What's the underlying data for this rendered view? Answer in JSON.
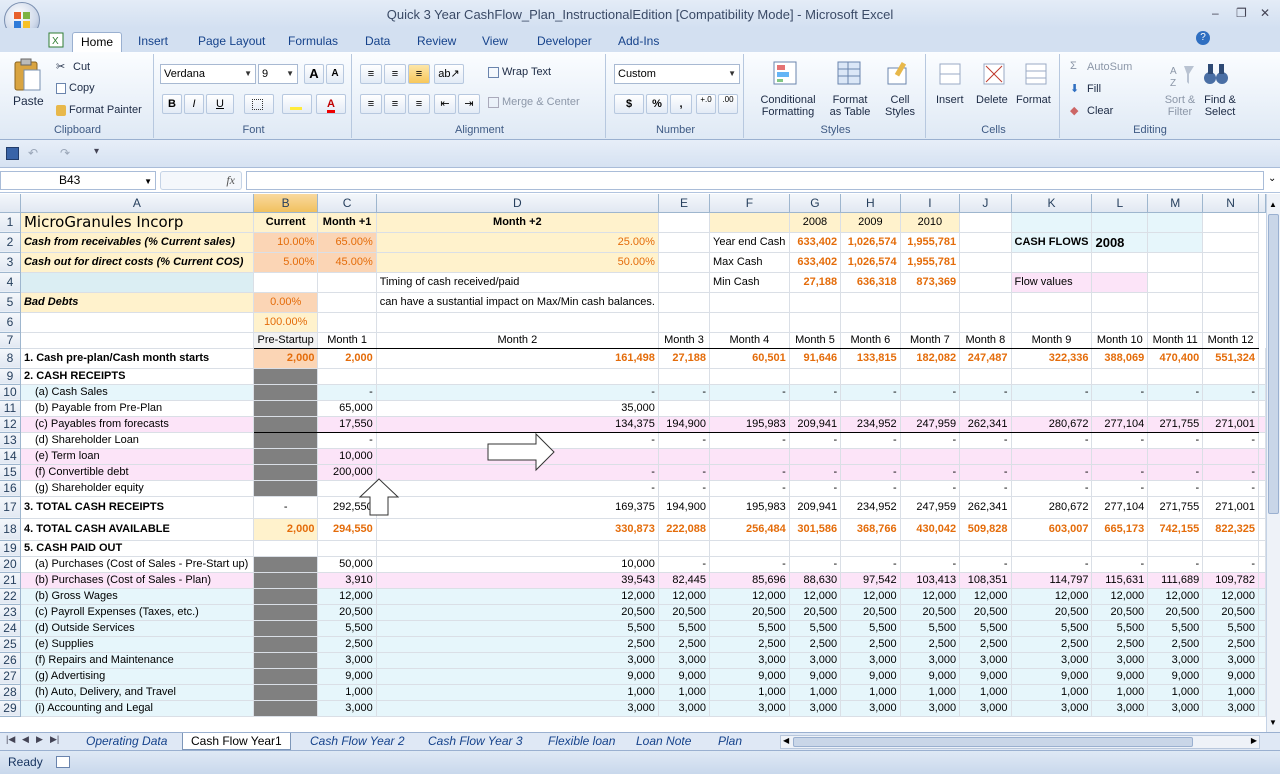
{
  "window": {
    "title": "Quick 3 Year CashFlow_Plan_InstructionalEdition  [Compatibility Mode] - Microsoft Excel",
    "minimize": "–",
    "restore": "❐",
    "close": "✕"
  },
  "ribbon_tabs": [
    "Home",
    "Insert",
    "Page Layout",
    "Formulas",
    "Data",
    "Review",
    "View",
    "Developer",
    "Add-Ins"
  ],
  "ribbon": {
    "clipboard": {
      "label": "Clipboard",
      "paste": "Paste",
      "cut": "Cut",
      "copy": "Copy",
      "format_painter": "Format Painter"
    },
    "font": {
      "label": "Font",
      "name": "Verdana",
      "size": "9",
      "grow": "A",
      "shrink": "A",
      "bold": "B",
      "italic": "I",
      "underline": "U"
    },
    "alignment": {
      "label": "Alignment",
      "wrap_text": "Wrap Text",
      "merge_center": "Merge & Center"
    },
    "number": {
      "label": "Number",
      "format": "Custom",
      "currency": "$",
      "percent": "%",
      "comma": ",",
      "inc_dec": "←.0\n.00",
      "dec_dec": ".00\n→.0"
    },
    "styles": {
      "label": "Styles",
      "conditional": "Conditional",
      "conditional2": "Formatting",
      "format_table": "Format",
      "format_table2": "as Table",
      "cell_styles": "Cell",
      "cell_styles2": "Styles"
    },
    "cells": {
      "label": "Cells",
      "insert": "Insert",
      "delete": "Delete",
      "format": "Format"
    },
    "editing": {
      "label": "Editing",
      "autosum": "AutoSum",
      "fill": "Fill",
      "clear": "Clear",
      "sort": "Sort &",
      "sort2": "Filter",
      "find": "Find &",
      "find2": "Select"
    }
  },
  "formula_bar": {
    "name_box": "B43",
    "fx": "fx",
    "formula": ""
  },
  "columns": [
    "A",
    "B",
    "C",
    "D",
    "E",
    "F",
    "G",
    "H",
    "I",
    "J",
    "K",
    "L",
    "M",
    "N"
  ],
  "selected_column": "B",
  "header_block": {
    "company": "MicroGranules Incorp",
    "current": "Current",
    "month1": "Month +1",
    "month2": "Month +2",
    "receivables_label": "Cash from receivables (% Current sales)",
    "receivables": [
      "10.00%",
      "65.00%",
      "25.00%"
    ],
    "cashout_label": "Cash out for direct costs (% Current COS)",
    "cashout": [
      "5.00%",
      "45.00%",
      "50.00%"
    ],
    "bad_debts_label": "Bad Debts",
    "bad_debts": "0.00%",
    "total_pct": "100.00%",
    "note1": "Timing of cash received/paid",
    "note2": "can have a sustantial impact on Max/Min cash balances.",
    "years": [
      "2008",
      "2009",
      "2010"
    ],
    "year_end_label": "Year end Cash",
    "year_end": [
      "633,402",
      "1,026,574",
      "1,955,781"
    ],
    "max_label": "Max Cash",
    "max": [
      "633,402",
      "1,026,574",
      "1,955,781"
    ],
    "min_label": "Min Cash",
    "min": [
      "27,188",
      "636,318",
      "873,369"
    ],
    "cashflows_label": "CASH FLOWS",
    "cashflows_year": "2008",
    "flow_values": "Flow values"
  },
  "months_header": [
    "Pre-Startup",
    "Month 1",
    "Month 2",
    "Month 3",
    "Month 4",
    "Month 5",
    "Month 6",
    "Month 7",
    "Month 8",
    "Month 9",
    "Month 10",
    "Month 11",
    "Month 12"
  ],
  "rows": [
    {
      "n": "8",
      "label": "1. Cash pre-plan/Cash month starts",
      "style": "start",
      "vals": [
        "2,000",
        "2,000",
        "161,498",
        "27,188",
        "60,501",
        "91,646",
        "133,815",
        "182,082",
        "247,487",
        "322,336",
        "388,069",
        "470,400",
        "551,324"
      ]
    },
    {
      "n": "9",
      "label": "2. CASH RECEIPTS",
      "style": "section",
      "vals": [
        "",
        "",
        "",
        "",
        "",
        "",
        "",
        "",
        "",
        "",
        "",
        "",
        ""
      ]
    },
    {
      "n": "10",
      "label": "(a) Cash Sales",
      "style": "cyan",
      "vals": [
        "",
        "-",
        "-",
        "-",
        "-",
        "-",
        "-",
        "-",
        "-",
        "-",
        "-",
        "-",
        "-"
      ]
    },
    {
      "n": "11",
      "label": "(b) Payable from Pre-Plan",
      "style": "plain",
      "vals": [
        "",
        "65,000",
        "35,000",
        "",
        "",
        "",
        "",
        "",
        "",
        "",
        "",
        "",
        ""
      ]
    },
    {
      "n": "12",
      "label": "(c) Payables from forecasts",
      "style": "pinkbox",
      "vals": [
        "",
        "17,550",
        "134,375",
        "194,900",
        "195,983",
        "209,941",
        "234,952",
        "247,959",
        "262,341",
        "280,672",
        "277,104",
        "271,755",
        "271,001"
      ]
    },
    {
      "n": "13",
      "label": "(d) Shareholder Loan",
      "style": "plain",
      "vals": [
        "",
        "-",
        "-",
        "-",
        "-",
        "-",
        "-",
        "-",
        "-",
        "-",
        "-",
        "-",
        "-"
      ]
    },
    {
      "n": "14",
      "label": "(e) Term loan",
      "style": "pink",
      "vals": [
        "",
        "10,000",
        "",
        "",
        "",
        "",
        "",
        "",
        "",
        "",
        "",
        "",
        ""
      ]
    },
    {
      "n": "15",
      "label": "(f) Convertible debt",
      "style": "pink",
      "vals": [
        "",
        "200,000",
        "-",
        "-",
        "-",
        "-",
        "-",
        "-",
        "-",
        "-",
        "-",
        "-",
        "-"
      ]
    },
    {
      "n": "16",
      "label": "(g) Shareholder equity",
      "style": "plain",
      "vals": [
        "",
        "-",
        "-",
        "-",
        "-",
        "-",
        "-",
        "-",
        "-",
        "-",
        "-",
        "-",
        "-"
      ]
    },
    {
      "n": "17",
      "label": "3. TOTAL CASH RECEIPTS",
      "style": "total",
      "vals": [
        "-",
        "292,550",
        "169,375",
        "194,900",
        "195,983",
        "209,941",
        "234,952",
        "247,959",
        "262,341",
        "280,672",
        "277,104",
        "271,755",
        "271,001"
      ]
    },
    {
      "n": "18",
      "label": "4. TOTAL CASH AVAILABLE",
      "style": "available",
      "vals": [
        "2,000",
        "294,550",
        "330,873",
        "222,088",
        "256,484",
        "301,586",
        "368,766",
        "430,042",
        "509,828",
        "603,007",
        "665,173",
        "742,155",
        "822,325"
      ]
    },
    {
      "n": "19",
      "label": "5. CASH PAID OUT",
      "style": "section",
      "vals": [
        "",
        "",
        "",
        "",
        "",
        "",
        "",
        "",
        "",
        "",
        "",
        "",
        ""
      ]
    },
    {
      "n": "20",
      "label": "(a) Purchases (Cost of Sales - Pre-Start up)",
      "style": "plain",
      "vals": [
        "",
        "50,000",
        "10,000",
        "-",
        "-",
        "-",
        "-",
        "-",
        "-",
        "-",
        "-",
        "-",
        "-"
      ]
    },
    {
      "n": "21",
      "label": "(b) Purchases (Cost of Sales - Plan)",
      "style": "pink",
      "vals": [
        "",
        "3,910",
        "39,543",
        "82,445",
        "85,696",
        "88,630",
        "97,542",
        "103,413",
        "108,351",
        "114,797",
        "115,631",
        "111,689",
        "109,782"
      ]
    },
    {
      "n": "22",
      "label": "(b) Gross Wages",
      "style": "cyan",
      "vals": [
        "",
        "12,000",
        "12,000",
        "12,000",
        "12,000",
        "12,000",
        "12,000",
        "12,000",
        "12,000",
        "12,000",
        "12,000",
        "12,000",
        "12,000"
      ]
    },
    {
      "n": "23",
      "label": "(c) Payroll Expenses (Taxes, etc.)",
      "style": "cyan",
      "vals": [
        "",
        "20,500",
        "20,500",
        "20,500",
        "20,500",
        "20,500",
        "20,500",
        "20,500",
        "20,500",
        "20,500",
        "20,500",
        "20,500",
        "20,500"
      ]
    },
    {
      "n": "24",
      "label": "(d) Outside Services",
      "style": "cyan",
      "vals": [
        "",
        "5,500",
        "5,500",
        "5,500",
        "5,500",
        "5,500",
        "5,500",
        "5,500",
        "5,500",
        "5,500",
        "5,500",
        "5,500",
        "5,500"
      ]
    },
    {
      "n": "25",
      "label": "(e) Supplies",
      "style": "cyan",
      "vals": [
        "",
        "2,500",
        "2,500",
        "2,500",
        "2,500",
        "2,500",
        "2,500",
        "2,500",
        "2,500",
        "2,500",
        "2,500",
        "2,500",
        "2,500"
      ]
    },
    {
      "n": "26",
      "label": "(f) Repairs and Maintenance",
      "style": "cyan",
      "vals": [
        "",
        "3,000",
        "3,000",
        "3,000",
        "3,000",
        "3,000",
        "3,000",
        "3,000",
        "3,000",
        "3,000",
        "3,000",
        "3,000",
        "3,000"
      ]
    },
    {
      "n": "27",
      "label": "(g) Advertising",
      "style": "cyan",
      "vals": [
        "",
        "9,000",
        "9,000",
        "9,000",
        "9,000",
        "9,000",
        "9,000",
        "9,000",
        "9,000",
        "9,000",
        "9,000",
        "9,000",
        "9,000"
      ]
    },
    {
      "n": "28",
      "label": "(h) Auto, Delivery, and Travel",
      "style": "cyan",
      "vals": [
        "",
        "1,000",
        "1,000",
        "1,000",
        "1,000",
        "1,000",
        "1,000",
        "1,000",
        "1,000",
        "1,000",
        "1,000",
        "1,000",
        "1,000"
      ]
    },
    {
      "n": "29",
      "label": "(i) Accounting and Legal",
      "style": "cyan",
      "vals": [
        "",
        "3,000",
        "3,000",
        "3,000",
        "3,000",
        "3,000",
        "3,000",
        "3,000",
        "3,000",
        "3,000",
        "3,000",
        "3,000",
        "3,000"
      ]
    }
  ],
  "sheet_tabs": [
    "Operating Data",
    "Cash Flow Year1",
    "Cash Flow Year 2",
    "Cash Flow Year 3",
    "Flexible loan",
    "Loan Note",
    "Plan Sum"
  ],
  "active_sheet": "Cash Flow Year1",
  "status": "Ready",
  "colors": {
    "accent_orange": "#e46c0a",
    "cream": "#fff2cc",
    "peach": "#fbd5b5",
    "pink": "#fce4f8",
    "cyan": "#e6f6fb"
  }
}
